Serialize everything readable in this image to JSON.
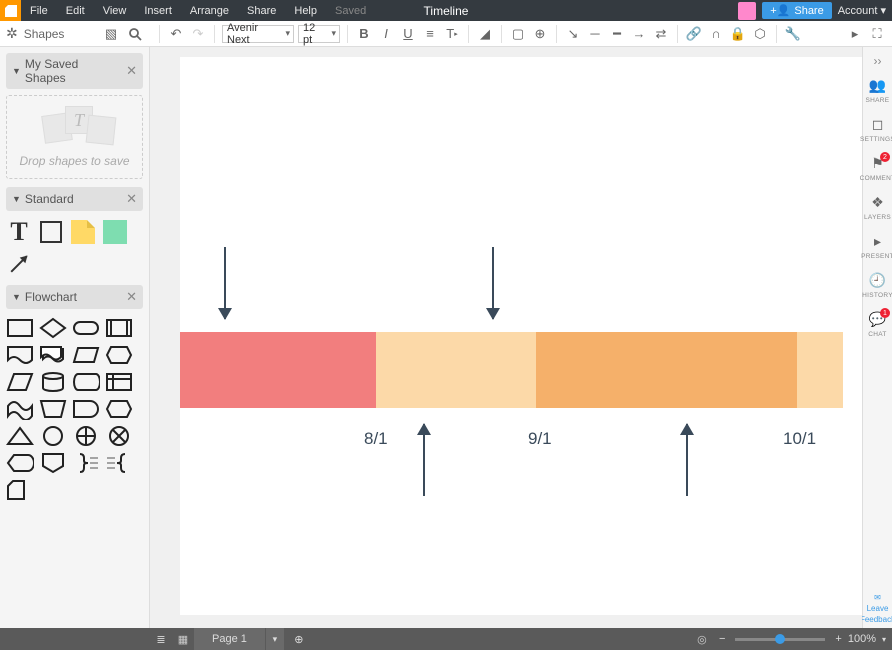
{
  "menubar": {
    "items": [
      "File",
      "Edit",
      "View",
      "Insert",
      "Arrange",
      "Share",
      "Help"
    ],
    "saved": "Saved",
    "title": "Timeline",
    "share_btn": "Share",
    "account": "Account"
  },
  "toolbar": {
    "shapes_label": "Shapes",
    "font": "Avenir Next",
    "font_size": "12 pt"
  },
  "panels": {
    "saved": {
      "title": "My Saved Shapes",
      "dropzone": "Drop shapes to save"
    },
    "standard": {
      "title": "Standard"
    },
    "flowchart": {
      "title": "Flowchart"
    }
  },
  "canvas": {
    "labels": [
      "8/1",
      "9/1",
      "10/1"
    ],
    "segments": [
      {
        "color": "#f27e7e"
      },
      {
        "color": "#fcd9a8"
      },
      {
        "color": "#f5b06a"
      },
      {
        "color": "#fcd9a8"
      }
    ]
  },
  "rsb": {
    "items": [
      {
        "label": "SHARE",
        "icon": "share"
      },
      {
        "label": "SETTINGS",
        "icon": "settings"
      },
      {
        "label": "COMMENT",
        "icon": "comment",
        "badge": "2"
      },
      {
        "label": "LAYERS",
        "icon": "layers"
      },
      {
        "label": "PRESENT",
        "icon": "present"
      },
      {
        "label": "HISTORY",
        "icon": "history"
      },
      {
        "label": "CHAT",
        "icon": "chat",
        "badge": "1"
      }
    ],
    "feedback_l1": "Leave",
    "feedback_l2": "Feedback"
  },
  "statusbar": {
    "page": "Page 1",
    "zoom": "100%"
  }
}
